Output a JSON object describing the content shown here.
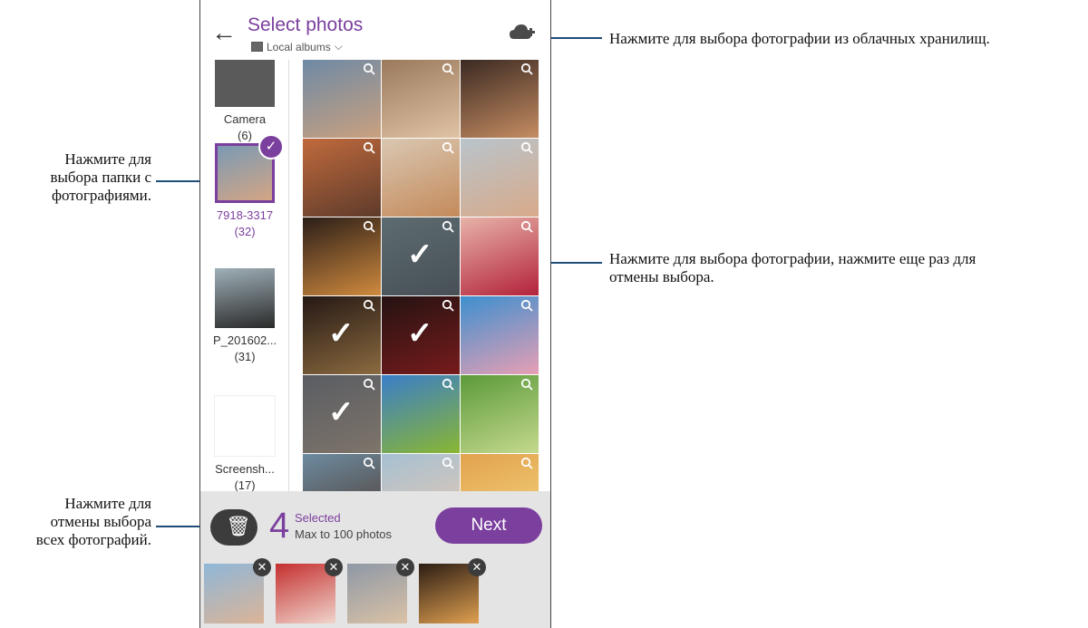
{
  "header": {
    "title": "Select photos",
    "subtitle": "Local albums"
  },
  "annotations": {
    "cloud": "Нажмите для выбора фотографии из облачных хранилищ.",
    "folder_1": "Нажмите для",
    "folder_2": "выбора папки с",
    "folder_3": "фотографиями.",
    "photo_1": "Нажмите для выбора фотографии, нажмите еще раз для",
    "photo_2": "отмены выбора.",
    "clear_1": "Нажмите для",
    "clear_2": "отмены выбора",
    "clear_3": "всех фотографий."
  },
  "albums": [
    {
      "label": "Camera",
      "count": "(6)"
    },
    {
      "label": "7918-3317",
      "count": "(32)",
      "selected": true
    },
    {
      "label": "P_201602...",
      "count": "(31)"
    },
    {
      "label": "Screensh...",
      "count": "(17)"
    }
  ],
  "grid": {
    "photos": [
      {
        "colors": [
          "#6e8aa6",
          "#c9a07e"
        ],
        "selected": false
      },
      {
        "colors": [
          "#9b7a5c",
          "#e0c3a4"
        ],
        "selected": false
      },
      {
        "colors": [
          "#3b2a22",
          "#c58c62"
        ],
        "selected": false
      },
      {
        "colors": [
          "#c06a3c",
          "#5e3b2b"
        ],
        "selected": false
      },
      {
        "colors": [
          "#d9c7b2",
          "#c48a5a"
        ],
        "selected": false
      },
      {
        "colors": [
          "#b9c4cc",
          "#d7aa8a"
        ],
        "selected": false
      },
      {
        "colors": [
          "#2b1e18",
          "#d08a3e"
        ],
        "selected": false
      },
      {
        "colors": [
          "#8fa6ad",
          "#6d7b84"
        ],
        "selected": true
      },
      {
        "colors": [
          "#e7b3a8",
          "#b3223a"
        ],
        "selected": false
      },
      {
        "colors": [
          "#3a2620",
          "#d6a462"
        ],
        "selected": true
      },
      {
        "colors": [
          "#3a1d1d",
          "#b72a2a"
        ],
        "selected": true
      },
      {
        "colors": [
          "#3d8fcf",
          "#e79fb4"
        ],
        "selected": false
      },
      {
        "colors": [
          "#8b8f99",
          "#c2b3a2"
        ],
        "selected": true
      },
      {
        "colors": [
          "#3a7ec9",
          "#8ab632"
        ],
        "selected": false
      },
      {
        "colors": [
          "#5b9a3a",
          "#c5d98e"
        ],
        "selected": false
      },
      {
        "colors": [
          "#6d8ba0",
          "#4e3b31"
        ],
        "selected": false
      },
      {
        "colors": [
          "#a6c0d2",
          "#e6c8b2"
        ],
        "selected": false
      },
      {
        "colors": [
          "#e2a24e",
          "#f3d37c"
        ],
        "selected": false
      }
    ]
  },
  "selection": {
    "count": "4",
    "label": "Selected",
    "limit": "Max to 100 photos",
    "next_label": "Next",
    "close_glyph": "✕",
    "thumbs": [
      {
        "colors": [
          "#8fb7d8",
          "#dbb497"
        ]
      },
      {
        "colors": [
          "#c4302f",
          "#f0d4cc"
        ]
      },
      {
        "colors": [
          "#8e98a6",
          "#dac2a6"
        ]
      },
      {
        "colors": [
          "#2c1d14",
          "#e0a050"
        ]
      }
    ]
  },
  "icons": {
    "back": "back-arrow-icon",
    "cloud": "cloud-add-icon",
    "search": "magnifier-icon",
    "check": "checkmark-icon",
    "trash": "trash-icon"
  },
  "colors": {
    "accent": "#7b3f9e",
    "leader": "#1f4e79"
  }
}
